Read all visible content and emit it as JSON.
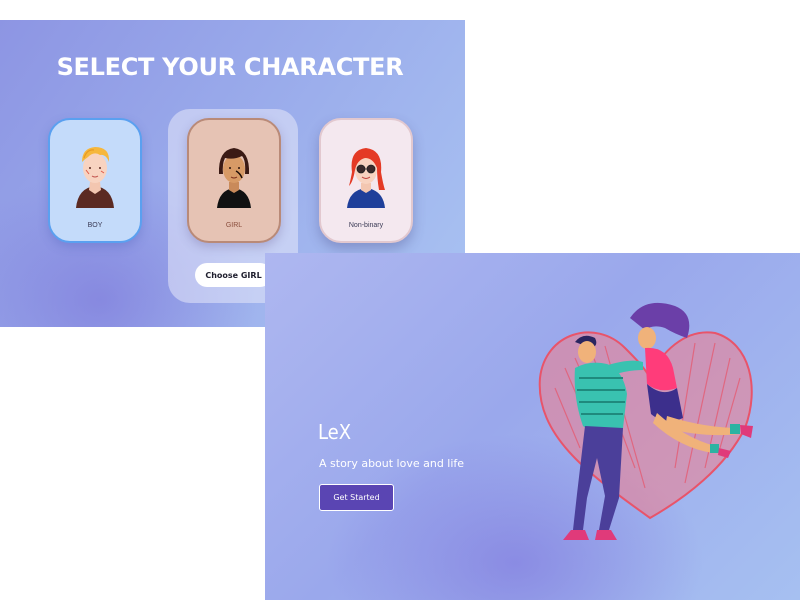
{
  "select_screen": {
    "title": "SELECT YOUR CHARACTER",
    "characters": [
      {
        "label": "BOY",
        "avatar": "boy-avatar"
      },
      {
        "label": "GIRL",
        "avatar": "girl-avatar",
        "selected": true
      },
      {
        "label": "Non-binary",
        "avatar": "non-binary-avatar"
      }
    ],
    "choose_button": "Choose GIRL"
  },
  "landing_screen": {
    "title": "LeX",
    "subtitle": "A story about love and life",
    "cta_button": "Get Started",
    "illustration": "couple-heart-illustration"
  },
  "colors": {
    "bg_gradient_start": "#8d95e3",
    "bg_gradient_end": "#a9c3f2",
    "boy_card": "#c4dbfa",
    "girl_card": "#e6c3b4",
    "nb_card": "#f4e8ef",
    "cta_button": "#5a45b3",
    "heart": "#f07a8a"
  }
}
